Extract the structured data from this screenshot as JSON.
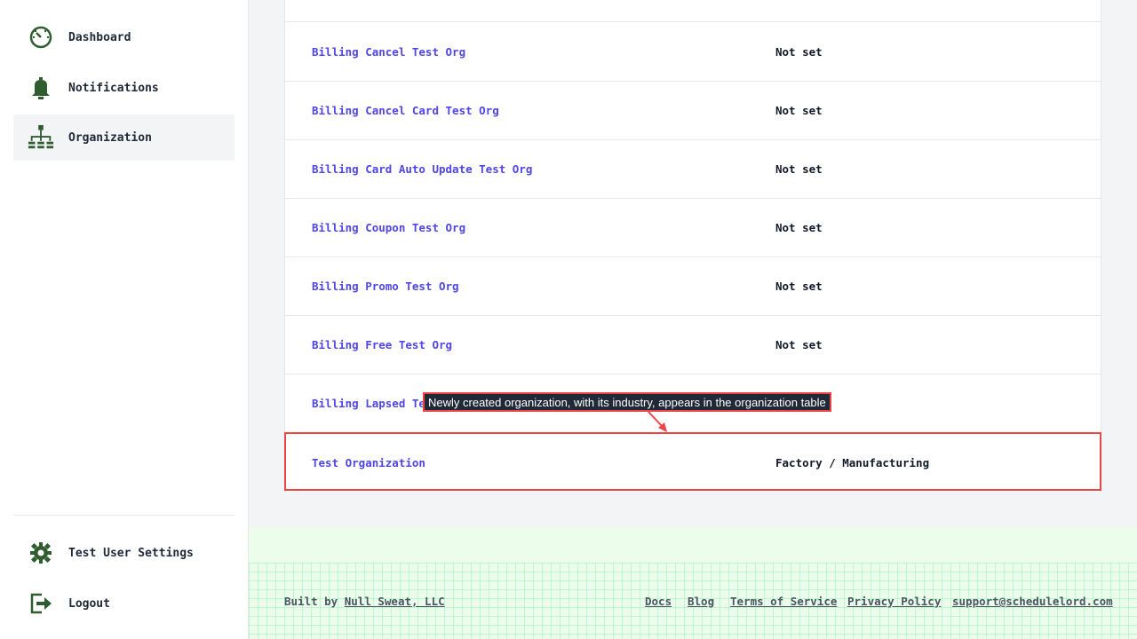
{
  "sidebar": {
    "items": [
      {
        "label": "Dashboard",
        "icon": "dashboard-icon"
      },
      {
        "label": "Notifications",
        "icon": "bell-icon"
      },
      {
        "label": "Organization",
        "icon": "org-chart-icon",
        "active": true
      }
    ],
    "bottom_items": [
      {
        "label": "Test User Settings",
        "icon": "gear-icon"
      },
      {
        "label": "Logout",
        "icon": "logout-icon"
      }
    ]
  },
  "table": {
    "rows": [
      {
        "name": "Billing Cancel Test Org",
        "industry": "Not set"
      },
      {
        "name": "Billing Cancel Card Test Org",
        "industry": "Not set"
      },
      {
        "name": "Billing Card Auto Update Test Org",
        "industry": "Not set"
      },
      {
        "name": "Billing Coupon Test Org",
        "industry": "Not set"
      },
      {
        "name": "Billing Promo Test Org",
        "industry": "Not set"
      },
      {
        "name": "Billing Free Test Org",
        "industry": "Not set"
      },
      {
        "name": "Billing Lapsed Tes",
        "industry": ""
      },
      {
        "name": "Test Organization",
        "industry": "Factory / Manufacturing"
      }
    ]
  },
  "annotation": {
    "text": "Newly created organization, with its industry, appears in the organization table"
  },
  "footer": {
    "built_by_prefix": "Built by",
    "built_by_link": "Null Sweat, LLC",
    "links": [
      "Docs",
      "Blog",
      "Terms of Service",
      "Privacy Policy",
      "support@schedulelord.com"
    ]
  },
  "colors": {
    "accent": "#4f46e5",
    "icon_green": "#2f5d2f",
    "highlight": "#ef4444"
  }
}
